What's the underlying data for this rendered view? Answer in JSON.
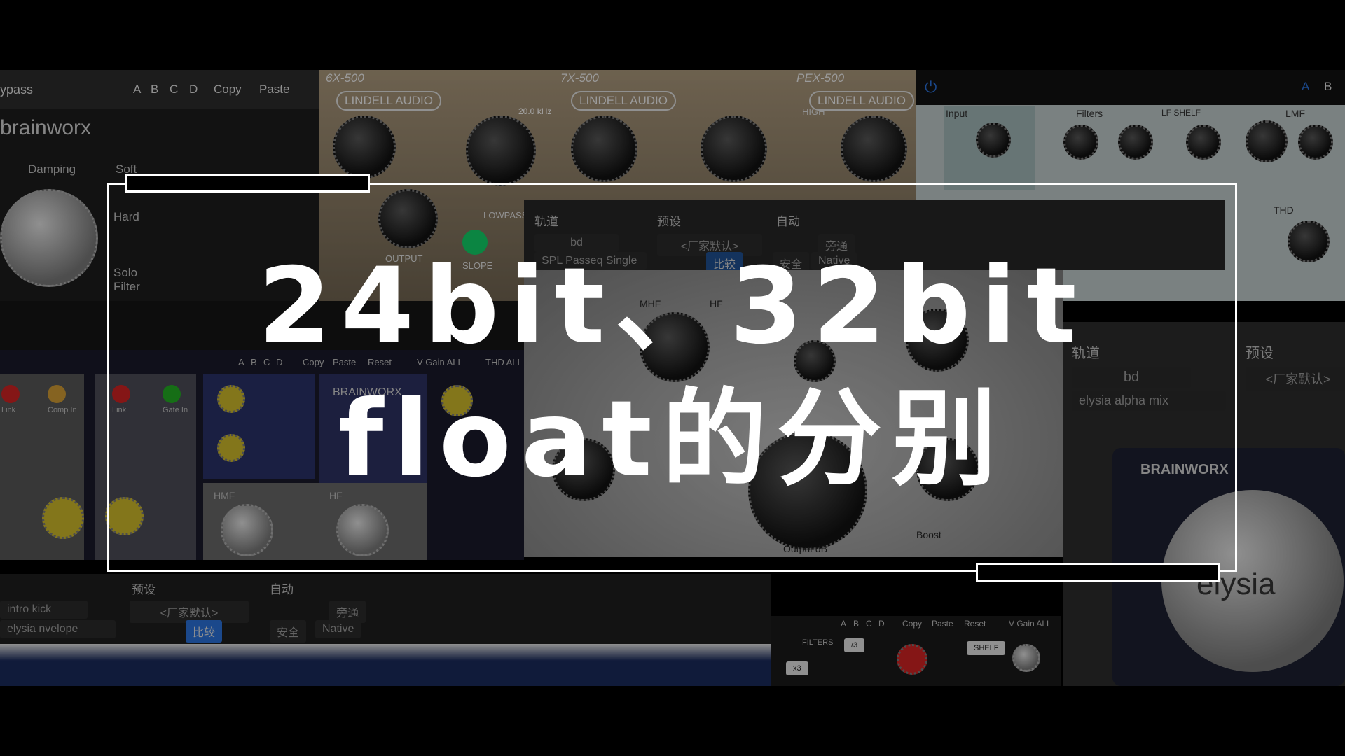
{
  "title": {
    "line1": "24bit、32bit",
    "line2": "float的分别"
  },
  "brainworx_panel": {
    "toolbar": [
      "ypass",
      "A",
      "B",
      "C",
      "D",
      "Copy",
      "Paste"
    ],
    "logo": "brainworx",
    "labels": [
      "Damping",
      "Soft",
      "Hard",
      "Solo Filter"
    ]
  },
  "lindell_panel": {
    "modules": [
      "6X-500",
      "7X-500",
      "PEX-500"
    ],
    "brand": "LINDELL AUDIO",
    "labels": [
      "20.0 kHz",
      "LOWPASS",
      "SLOPE",
      "OUTPUT",
      "HIGH"
    ]
  },
  "eq_panel": {
    "labels": [
      "Input",
      "Filters",
      "LF SHELF",
      "LMF",
      "THD"
    ],
    "ab": [
      "A",
      "B"
    ]
  },
  "host_window": {
    "headers": [
      "轨道",
      "预设",
      "自动"
    ],
    "track": "bd",
    "preset": "<厂家默认>",
    "bypass": "旁通",
    "plugin": "SPL Passeq Single",
    "compare": "比较",
    "safe": "安全",
    "mode": "Native"
  },
  "console_panel": {
    "toolbar": [
      "A",
      "B",
      "C",
      "D",
      "Copy",
      "Paste",
      "Reset",
      "V Gain ALL",
      "THD ALL"
    ],
    "brand": "BRAINWORX",
    "labels": [
      "Link",
      "Comp In",
      "Link",
      "Gate In",
      "HMF",
      "HF"
    ]
  },
  "spl_panel": {
    "labels": [
      "MHF",
      "HF",
      "Output dB",
      "Boost"
    ]
  },
  "bottom_host": {
    "headers": [
      "预设",
      "自动"
    ],
    "track": "intro kick",
    "preset": "<厂家默认>",
    "plugin": "elysia nvelope",
    "bypass": "旁通",
    "compare": "比较",
    "safe": "安全",
    "mode": "Native"
  },
  "bottom_right": {
    "toolbar": [
      "A",
      "B",
      "C",
      "D",
      "Copy",
      "Paste",
      "Reset",
      "V Gain ALL"
    ],
    "labels": [
      "FILTERS",
      "SHELF",
      "x3",
      "/3"
    ]
  },
  "elysia_panel": {
    "headers": [
      "轨道",
      "预设"
    ],
    "track": "bd",
    "preset": "<厂家默认>",
    "plugin": "elysia alpha mix",
    "brand": "BRAINWORX",
    "logo": "elysia"
  },
  "colors": {
    "accent_blue": "#2a6fd6",
    "tan": "#a8967a",
    "teal_bg": "#9fb4b4",
    "led_red": "#c22",
    "led_green": "#2a2",
    "knob_yellow": "#c9b52a"
  }
}
